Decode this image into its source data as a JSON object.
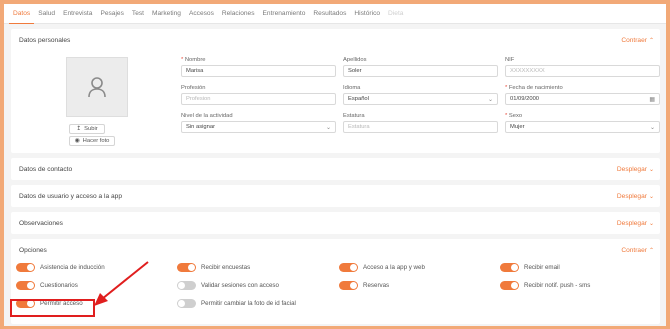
{
  "tabs": [
    {
      "label": "Datos",
      "active": true
    },
    {
      "label": "Salud"
    },
    {
      "label": "Entrevista"
    },
    {
      "label": "Pesajes"
    },
    {
      "label": "Test"
    },
    {
      "label": "Marketing"
    },
    {
      "label": "Accesos"
    },
    {
      "label": "Relaciones"
    },
    {
      "label": "Entrenamiento"
    },
    {
      "label": "Resultados"
    },
    {
      "label": "Histórico"
    },
    {
      "label": "Dieta",
      "disabled": true
    }
  ],
  "personal": {
    "title": "Datos personales",
    "collapse_label": "Contraer",
    "upload_label": "Subir",
    "photo_label": "Hacer foto",
    "nombre": {
      "label": "Nombre",
      "value": "Marisa"
    },
    "apellidos": {
      "label": "Apellidos",
      "value": "Soler"
    },
    "nif": {
      "label": "NIF",
      "placeholder": "XXXXXXXXX"
    },
    "profesion": {
      "label": "Profesión",
      "placeholder": "Profesion"
    },
    "idioma": {
      "label": "Idioma",
      "value": "Español"
    },
    "fecha": {
      "label": "Fecha de nacimiento",
      "value": "01/09/2000"
    },
    "nivel": {
      "label": "Nivel de la actividad",
      "value": "Sin asignar"
    },
    "estatura": {
      "label": "Estatura",
      "placeholder": "Estatura"
    },
    "sexo": {
      "label": "Sexo",
      "value": "Mujer"
    }
  },
  "contacto": {
    "title": "Datos de contacto",
    "expand_label": "Desplegar"
  },
  "usuario": {
    "title": "Datos de usuario y acceso a la app",
    "expand_label": "Desplegar"
  },
  "observaciones": {
    "title": "Observaciones",
    "expand_label": "Desplegar"
  },
  "opciones": {
    "title": "Opciones",
    "collapse_label": "Contraer",
    "items": [
      {
        "label": "Asistencia de inducción",
        "on": true
      },
      {
        "label": "Recibir encuestas",
        "on": true
      },
      {
        "label": "Acceso a la app y web",
        "on": true
      },
      {
        "label": "Recibir email",
        "on": true
      },
      {
        "label": "Cuestionarios",
        "on": true
      },
      {
        "label": "Validar sesiones con acceso",
        "on": false
      },
      {
        "label": "Reservas",
        "on": true
      },
      {
        "label": "Recibir notif. push - sms",
        "on": true
      },
      {
        "label": "Permitir acceso",
        "on": true
      },
      {
        "label": "Permitir cambiar la foto de id facial",
        "on": false
      }
    ]
  },
  "colors": {
    "accent": "#f07a3c",
    "highlight": "#e01e1e",
    "frame": "#f2a977"
  }
}
